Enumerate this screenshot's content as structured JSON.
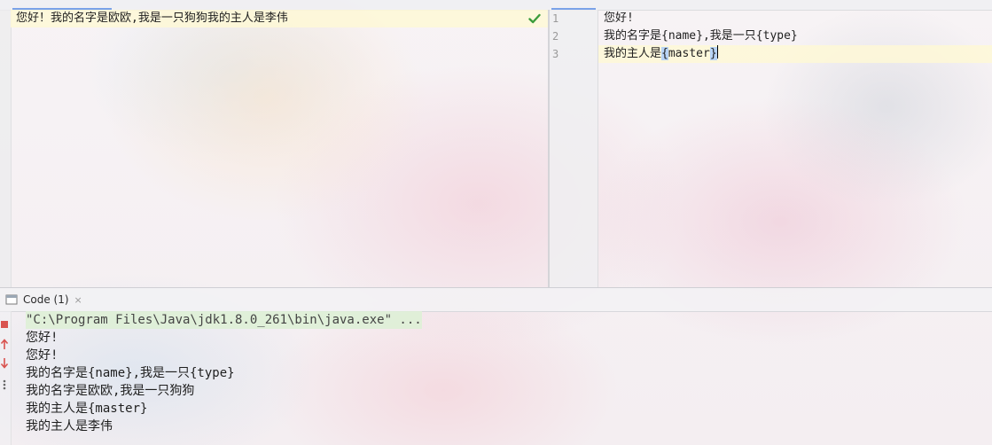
{
  "left_editor": {
    "lines": [
      "您好！我的名字是欧欧,我是一只狗狗我的主人是李伟"
    ],
    "check_icon": "check-icon",
    "check_color": "#3b9c3b"
  },
  "right_editor": {
    "line_numbers": [
      "1",
      "2",
      "3"
    ],
    "line1": "您好!",
    "line2": "我的名字是{name},我是一只{type}",
    "line3_prefix": "我的主人是",
    "line3_brace_open": "{",
    "line3_word": "master",
    "line3_brace_close": "}"
  },
  "run_window": {
    "tab_label": "Code (1)",
    "tab_close": "×",
    "toolbar_icons": [
      "stop-icon",
      "up-arrow-icon",
      "down-arrow-icon",
      "more-icon"
    ],
    "console_lines": [
      "\"C:\\Program Files\\Java\\jdk1.8.0_261\\bin\\java.exe\" ...",
      "您好!",
      "您好!",
      "我的名字是{name},我是一只{type}",
      "我的名字是欧欧,我是一只狗狗",
      "我的主人是{master}",
      "我的主人是李伟"
    ]
  },
  "colors": {
    "accent_tab": "#7aa2e8",
    "current_line": "#fef8d6",
    "brace_match": "#a0c8ff",
    "stop_red": "#d9534f"
  }
}
